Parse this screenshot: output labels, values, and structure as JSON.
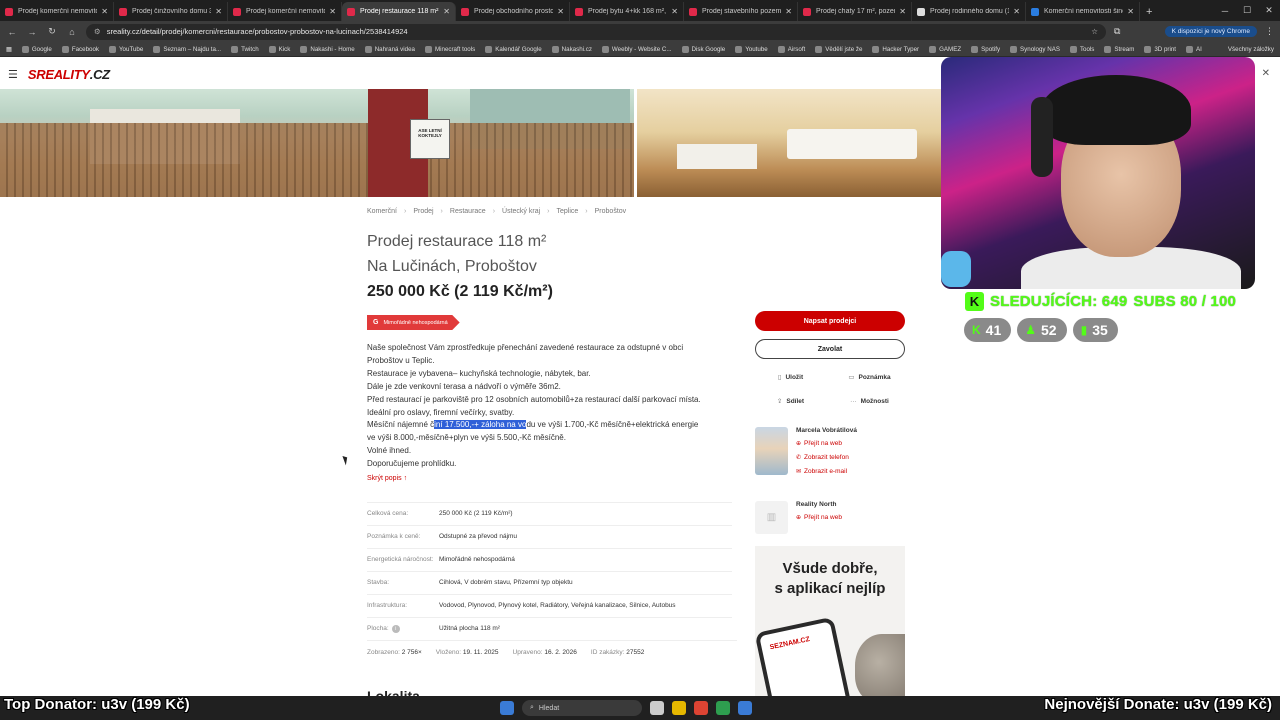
{
  "browser": {
    "tabs": [
      {
        "title": "Prodej komerční nemovitosti",
        "icon": "sreality-icon",
        "active": false
      },
      {
        "title": "Prodej činžovního domu 324",
        "icon": "sreality-icon",
        "active": false
      },
      {
        "title": "Prodej komerční nemovitosti",
        "icon": "sreality-icon",
        "active": false
      },
      {
        "title": "Prodej restaurace 118 m², Na",
        "icon": "sreality-icon",
        "active": true
      },
      {
        "title": "Prodej obchodního prostoru",
        "icon": "sreality-icon",
        "active": false
      },
      {
        "title": "Prodej bytu 4+kk 168 m², Šeli",
        "icon": "sreality-icon",
        "active": false
      },
      {
        "title": "Prodej stavebního pozemku",
        "icon": "sreality-icon",
        "active": false
      },
      {
        "title": "Prodej chaty 17 m², pozemek",
        "icon": "sreality-icon",
        "active": false
      },
      {
        "title": "Prodej rodinného domu (10)",
        "icon": "sreality-icon",
        "active": false
      },
      {
        "title": "Komerční nemovitosti šindlich",
        "icon": "sreality-icon",
        "active": false
      }
    ],
    "url": "sreality.cz/detail/prodej/komercni/restaurace/probostov-probostov-na-lucinach/2538414924",
    "promo": "K dispozici je nový Chrome",
    "bookmarks": [
      "Google",
      "Facebook",
      "YouTube",
      "Seznam – Najdu ta...",
      "Twitch",
      "Kick",
      "Nakashi - Home",
      "Nahraná videa",
      "Minecraft tools",
      "Kalendář Google",
      "Nakashi.cz",
      "Weebly - Website C...",
      "Disk Google",
      "Youtube",
      "Airsoft",
      "Vědělí jste že",
      "Hacker Typer",
      "GAMEZ",
      "Spotify",
      "Synology NAS",
      "Tools",
      "Stream",
      "3D print",
      "AI"
    ],
    "bookmarks_all": "Všechny záložky"
  },
  "site": {
    "logo_main": "SREALITY",
    "logo_tld": ".CZ"
  },
  "photo_sign_text": "ASE LETNÍ KOKTEJLY",
  "listing": {
    "breadcrumbs": [
      "Komerční",
      "Prodej",
      "Restaurace",
      "Ústecký kraj",
      "Teplice",
      "Proboštov"
    ],
    "title_line1": "Prodej restaurace 118 m²",
    "title_line2": "Na Lučinách, Proboštov",
    "price": "250 000 Kč (2 119 Kč/m²)",
    "energy_letter": "G",
    "energy_label": "Mimořádně nehospodárná",
    "description": {
      "l1": "Naše společnost Vám zprostředkuje přenechání zavedené restaurace za odstupné v obci",
      "l2": "Proboštov u Teplic.",
      "l3": "Restaurace je vybavena– kuchyňská technologie, nábytek, bar.",
      "l4": "Dále je zde venkovní terasa a nádvoří o výměře 36m2.",
      "l5": "Před restaurací je parkoviště pro 12 osobních automobilů+za restaurací další parkovací místa.",
      "l6": "Ideální pro oslavy, firemní večírky, svatby.",
      "l7_pre": "Měsíční nájemné č",
      "l7_hl": "iní 17.500,-+ záloha na vo",
      "l7_post": "du ve výši 1.700,-Kč měsíčně+elektrická energie",
      "l8": "ve výši  8.000,-měsíčně+plyn ve výši 5.500,-Kč měsíčně.",
      "l9": "Volné ihned.",
      "l10": "Doporučujeme prohlídku."
    },
    "hide_description": "Skrýt popis ↑",
    "params": [
      {
        "key": "Celková cena:",
        "value": "250 000 Kč (2 119 Kč/m²)"
      },
      {
        "key": "Poznámka k ceně:",
        "value": "Odstupné za převod nájmu"
      },
      {
        "key": "Energetická náročnost:",
        "value": "Mimořádně nehospodárná"
      },
      {
        "key": "Stavba:",
        "value": "Cihlová, V dobrém stavu, Přízemní typ objektu"
      },
      {
        "key": "Infrastruktura:",
        "value": "Vodovod, Plynovod, Plynový kotel, Radiátory, Veřejná kanalizace, Silnice, Autobus"
      },
      {
        "key": "Plocha:",
        "value": "Užitná plocha 118 m²"
      }
    ],
    "meta": {
      "views_label": "Zobrazeno:",
      "views": "2 756×",
      "posted_label": "Vloženo:",
      "posted": "19. 11. 2025",
      "edited_label": "Upraveno:",
      "edited": "16. 2. 2026",
      "id_label": "ID zakázky:",
      "id": "27552"
    },
    "next_section": "Lokalita"
  },
  "sidebar": {
    "write_seller": "Napsat prodejci",
    "call": "Zavolat",
    "save": "Uložit",
    "note": "Poznámka",
    "share": "Sdílet",
    "more": "Možnosti",
    "agent_name": "Marcela Vobrátilová",
    "agent_web": "Přejít na web",
    "agent_phone": "Zobrazit telefon",
    "agent_email": "Zobrazit e-mail",
    "agency_name": "Reality North",
    "agency_web": "Přejít na web",
    "ad_text_1": "Všude dobře,",
    "ad_text_2": "s aplikací nejlíp",
    "ad_phone_logo": "SEZNAM.CZ"
  },
  "stream": {
    "followers": "SLEDUJÍCÍCH: 649",
    "subs": "SUBS 80 / 100",
    "pill1": "41",
    "pill2": "52",
    "pill3": "35",
    "top_donor": "Top Donator: u3v (199 Kč)",
    "newest_donor": "Nejnovější Donate: u3v (199 Kč)"
  },
  "taskbar": {
    "search_placeholder": "Hledat"
  },
  "colors": {
    "brand_red": "#cc0000",
    "kick_green": "#53fc18",
    "selection_blue": "#2f60d8"
  }
}
